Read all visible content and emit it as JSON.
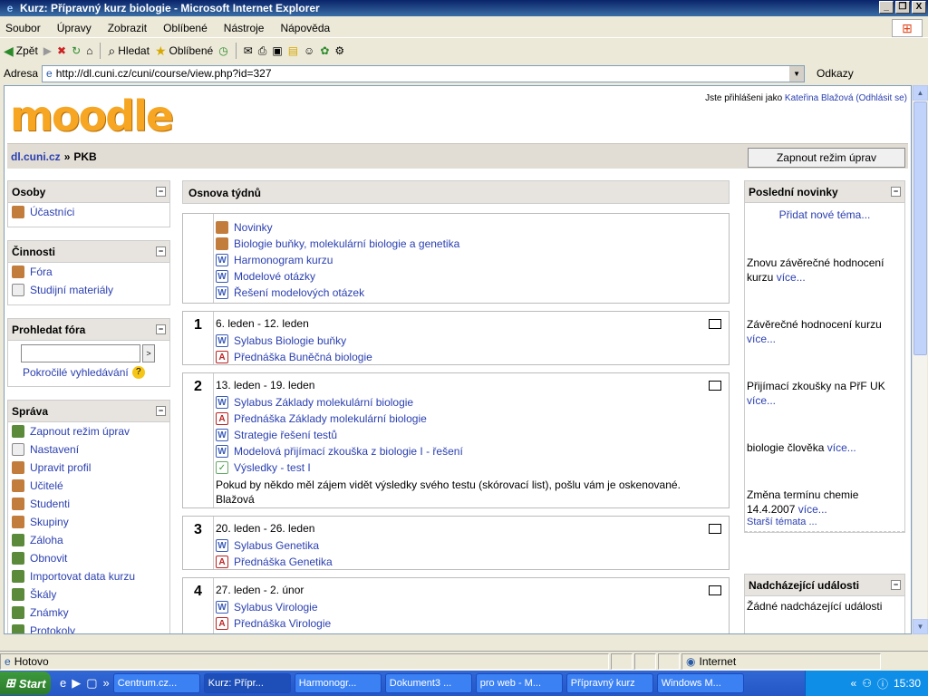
{
  "window": {
    "title": "Kurz: Přípravný kurz biologie - Microsoft Internet Explorer",
    "controls": [
      "_",
      "❐",
      "X"
    ]
  },
  "menu": [
    "Soubor",
    "Úpravy",
    "Zobrazit",
    "Oblíbené",
    "Nástroje",
    "Nápověda"
  ],
  "toolbar": {
    "back": "Zpět",
    "search": "Hledat",
    "favorites": "Oblíbené"
  },
  "address": {
    "label": "Adresa",
    "url": "http://dl.cuni.cz/cuni/course/view.php?id=327",
    "links": "Odkazy"
  },
  "page": {
    "logo": "moodle",
    "logged_prefix": "Jste přihlášeni jako",
    "user": "Kateřina Blažová",
    "logout": "(Odhlásit se)",
    "breadcrumb_home": "dl.cuni.cz",
    "breadcrumb_sep": "»",
    "breadcrumb_course": "PKB",
    "edit_button": "Zapnout režim úprav"
  },
  "blocks": {
    "people": {
      "title": "Osoby",
      "items": [
        "Účastníci"
      ]
    },
    "activities": {
      "title": "Činnosti",
      "items": [
        "Fóra",
        "Studijní materiály"
      ]
    },
    "search": {
      "title": "Prohledat fóra",
      "advanced": "Pokročilé vyhledávání",
      "button": ">"
    },
    "admin": {
      "title": "Správa",
      "items": [
        "Zapnout režim úprav",
        "Nastavení",
        "Upravit profil",
        "Učitelé",
        "Studenti",
        "Skupiny",
        "Záloha",
        "Obnovit",
        "Importovat data kurzu",
        "Škály",
        "Známky",
        "Protokoly"
      ]
    }
  },
  "main": {
    "title": "Osnova týdnů",
    "intro": [
      "Novinky",
      "Biologie buňky, molekulární biologie a genetika",
      "Harmonogram kurzu",
      "Modelové otázky",
      "Řešení modelových otázek"
    ],
    "weeks": [
      {
        "num": "1",
        "date": "6. leden - 12. leden",
        "items": [
          "Sylabus Biologie buňky",
          "Přednáška Buněčná biologie"
        ]
      },
      {
        "num": "2",
        "date": "13. leden - 19. leden",
        "items": [
          "Sylabus Základy molekulární biologie",
          "Přednáška Základy molekulární biologie",
          "Strategie řešení testů",
          "Modelová přijímací zkouška z biologie I - řešení",
          "Výsledky - test I"
        ],
        "note": "Pokud by někdo měl zájem vidět výsledky svého testu (skórovací list), pošlu vám je oskenované. Blažová"
      },
      {
        "num": "3",
        "date": "20. leden - 26. leden",
        "items": [
          "Sylabus Genetika",
          "Přednáška Genetika"
        ]
      },
      {
        "num": "4",
        "date": "27. leden - 2. únor",
        "items": [
          "Sylabus Virologie",
          "Přednáška Virologie"
        ]
      }
    ]
  },
  "news": {
    "title": "Poslední novinky",
    "add": "Přidat nové téma...",
    "more": "více...",
    "posts": [
      "Znovu závěrečné hodnocení kurzu",
      "Závěrečné hodnocení kurzu",
      "Přijímací zkoušky na PřF UK",
      "biologie člověka",
      "Změna termínu chemie 14.4.2007"
    ],
    "older": "Starší témata ..."
  },
  "upcoming": {
    "title": "Nadcházející události",
    "none": "Žádné nadcházející události"
  },
  "status": {
    "text": "Hotovo",
    "zone": "Internet"
  },
  "taskbar": {
    "start": "Start",
    "tasks": [
      "Centrum.cz...",
      "Kurz: Přípr...",
      "Harmonogr...",
      "Dokument3 ...",
      "pro web - M...",
      "Přípravný kurz",
      "Windows M..."
    ],
    "clock": "15:30"
  }
}
